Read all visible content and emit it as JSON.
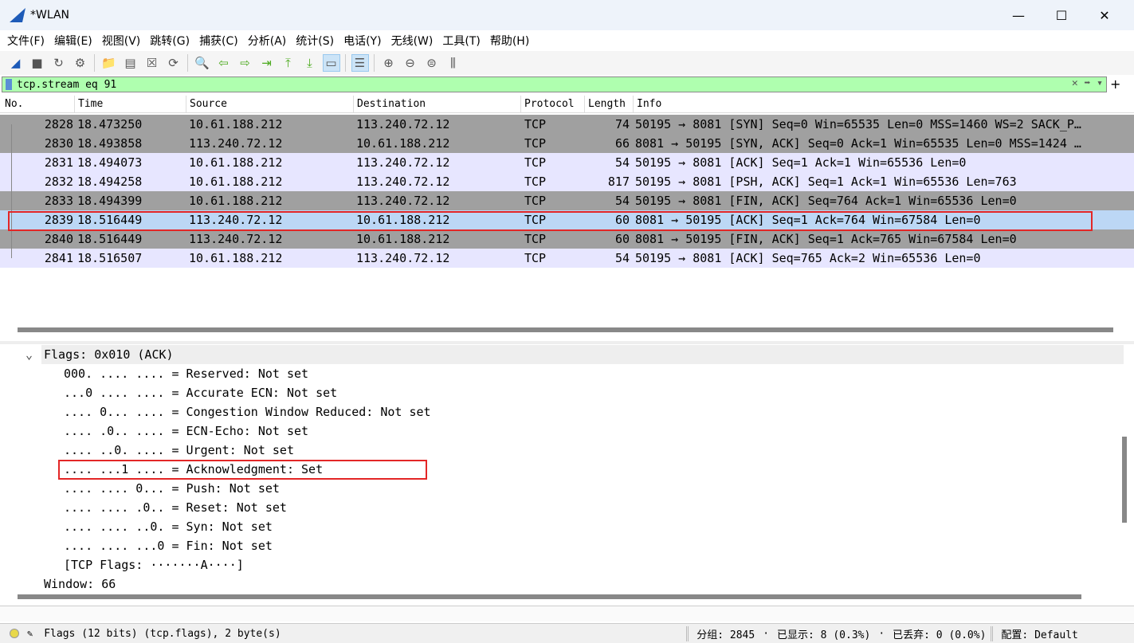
{
  "window": {
    "title": "*WLAN",
    "minimize": "—",
    "maximize": "☐",
    "close": "✕"
  },
  "menu": [
    "文件(F)",
    "编辑(E)",
    "视图(V)",
    "跳转(G)",
    "捕获(C)",
    "分析(A)",
    "统计(S)",
    "电话(Y)",
    "无线(W)",
    "工具(T)",
    "帮助(H)"
  ],
  "toolbar": [
    {
      "icon": "shark-fin-start-icon",
      "glyph": "◢"
    },
    {
      "icon": "stop-icon",
      "glyph": "■"
    },
    {
      "icon": "restart-icon",
      "glyph": "↻"
    },
    {
      "icon": "capture-options-icon",
      "glyph": "⚙"
    },
    {
      "icon": "open-file-icon",
      "glyph": "📁"
    },
    {
      "icon": "save-file-icon",
      "glyph": "▤"
    },
    {
      "icon": "close-file-icon",
      "glyph": "☒"
    },
    {
      "icon": "reload-icon",
      "glyph": "⟳"
    },
    {
      "icon": "find-icon",
      "glyph": "🔍"
    },
    {
      "icon": "go-back-icon",
      "glyph": "⇦"
    },
    {
      "icon": "go-forward-icon",
      "glyph": "⇨"
    },
    {
      "icon": "go-to-packet-icon",
      "glyph": "⇥"
    },
    {
      "icon": "first-packet-icon",
      "glyph": "⤒"
    },
    {
      "icon": "last-packet-icon",
      "glyph": "⤓"
    },
    {
      "icon": "autoscroll-icon",
      "glyph": "▭"
    },
    {
      "icon": "colorize-icon",
      "glyph": "☰"
    },
    {
      "icon": "zoom-in-icon",
      "glyph": "⊕"
    },
    {
      "icon": "zoom-out-icon",
      "glyph": "⊖"
    },
    {
      "icon": "zoom-normal-icon",
      "glyph": "⊜"
    },
    {
      "icon": "resize-columns-icon",
      "glyph": "⫼"
    }
  ],
  "filter": {
    "value": "tcp.stream eq 91",
    "clear": "✕",
    "apply": "➡",
    "dropdown": "▾",
    "add": "+"
  },
  "columns": [
    "No.",
    "Time",
    "Source",
    "Destination",
    "Protocol",
    "Length",
    "Info"
  ],
  "packets": [
    {
      "no": "2828",
      "time": "18.473250",
      "src": "10.61.188.212",
      "dst": "113.240.72.12",
      "proto": "TCP",
      "len": "74",
      "info": "50195 → 8081 [SYN] Seq=0 Win=65535 Len=0 MSS=1460 WS=2 SACK_P…",
      "style": "gray"
    },
    {
      "no": "2830",
      "time": "18.493858",
      "src": "113.240.72.12",
      "dst": "10.61.188.212",
      "proto": "TCP",
      "len": "66",
      "info": "8081 → 50195 [SYN, ACK] Seq=0 Ack=1 Win=65535 Len=0 MSS=1424 …",
      "style": "gray"
    },
    {
      "no": "2831",
      "time": "18.494073",
      "src": "10.61.188.212",
      "dst": "113.240.72.12",
      "proto": "TCP",
      "len": "54",
      "info": "50195 → 8081 [ACK] Seq=1 Ack=1 Win=65536 Len=0",
      "style": "lav"
    },
    {
      "no": "2832",
      "time": "18.494258",
      "src": "10.61.188.212",
      "dst": "113.240.72.12",
      "proto": "TCP",
      "len": "817",
      "info": "50195 → 8081 [PSH, ACK] Seq=1 Ack=1 Win=65536 Len=763",
      "style": "lav"
    },
    {
      "no": "2833",
      "time": "18.494399",
      "src": "10.61.188.212",
      "dst": "113.240.72.12",
      "proto": "TCP",
      "len": "54",
      "info": "50195 → 8081 [FIN, ACK] Seq=764 Ack=1 Win=65536 Len=0",
      "style": "gray"
    },
    {
      "no": "2839",
      "time": "18.516449",
      "src": "113.240.72.12",
      "dst": "10.61.188.212",
      "proto": "TCP",
      "len": "60",
      "info": "8081 → 50195 [ACK] Seq=1 Ack=764 Win=67584 Len=0",
      "style": "sel"
    },
    {
      "no": "2840",
      "time": "18.516449",
      "src": "113.240.72.12",
      "dst": "10.61.188.212",
      "proto": "TCP",
      "len": "60",
      "info": "8081 → 50195 [FIN, ACK] Seq=1 Ack=765 Win=67584 Len=0",
      "style": "gray"
    },
    {
      "no": "2841",
      "time": "18.516507",
      "src": "10.61.188.212",
      "dst": "113.240.72.12",
      "proto": "TCP",
      "len": "54",
      "info": "50195 → 8081 [ACK] Seq=765 Ack=2 Win=65536 Len=0",
      "style": "lav"
    }
  ],
  "details": {
    "header": "Flags: 0x010 (ACK)",
    "lines": [
      "000. .... .... = Reserved: Not set",
      "...0 .... .... = Accurate ECN: Not set",
      ".... 0... .... = Congestion Window Reduced: Not set",
      ".... .0.. .... = ECN-Echo: Not set",
      ".... ..0. .... = Urgent: Not set",
      ".... ...1 .... = Acknowledgment: Set",
      ".... .... 0... = Push: Not set",
      ".... .... .0.. = Reset: Not set",
      ".... .... ..0. = Syn: Not set",
      ".... .... ...0 = Fin: Not set",
      "[TCP Flags: ·······A····]"
    ],
    "footer": "Window: 66"
  },
  "status": {
    "field": "Flags (12 bits) (tcp.flags), 2 byte(s)",
    "packets": "分组: 2845",
    "displayed": "已显示: 8 (0.3%)",
    "dropped": "已丢弃: 0 (0.0%)",
    "profile": "配置: Default",
    "sep": "·"
  }
}
